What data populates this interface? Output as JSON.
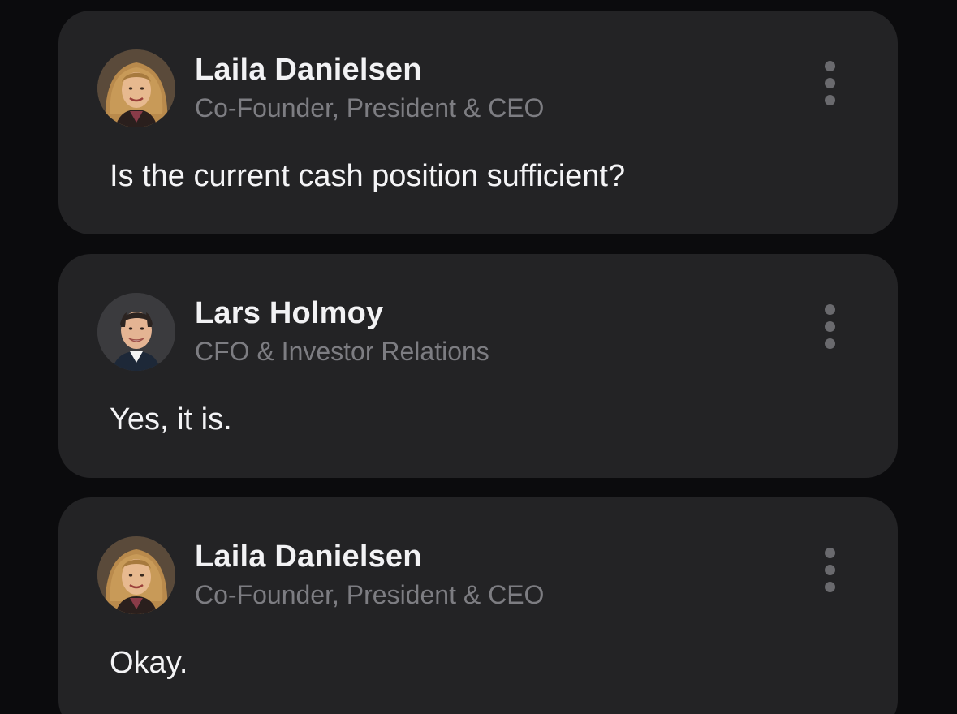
{
  "messages": [
    {
      "author": "Laila Danielsen",
      "role": "Co-Founder, President & CEO",
      "text": "Is the current cash position sufficient?",
      "avatar_icon": "woman-portrait"
    },
    {
      "author": "Lars Holmoy",
      "role": "CFO & Investor Relations",
      "text": "Yes, it is.",
      "avatar_icon": "man-portrait"
    },
    {
      "author": "Laila Danielsen",
      "role": "Co-Founder, President & CEO",
      "text": "Okay.",
      "avatar_icon": "woman-portrait"
    }
  ],
  "colors": {
    "background": "#0b0b0d",
    "card": "#232325",
    "name": "#f2f2f4",
    "role": "#7d7d82",
    "message": "#f4f4f6",
    "menu_dots": "#6a6a6e"
  },
  "menu_icon": "more-vertical-icon"
}
